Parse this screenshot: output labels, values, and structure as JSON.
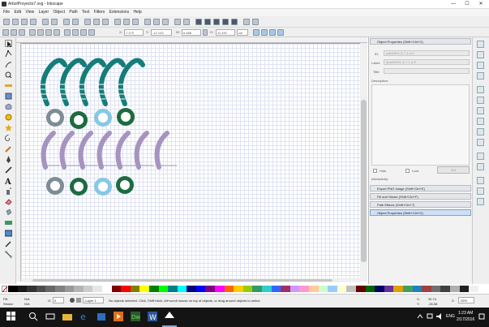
{
  "window": {
    "title": "ArbolProyecto7.svg - Inkscape",
    "buttons": [
      "—",
      "☐",
      "✕"
    ]
  },
  "menubar": [
    "File",
    "Edit",
    "View",
    "Layer",
    "Object",
    "Path",
    "Text",
    "Filters",
    "Extensions",
    "Help"
  ],
  "controls": {
    "x_label": "X:",
    "x_value": "7.270",
    "y_label": "Y:",
    "y_value": "-12.143",
    "w_label": "W:",
    "w_value": "6.488",
    "h_label": "H:",
    "h_value": "11.491",
    "unit": "cm"
  },
  "object_properties": {
    "header": "Object Properties (Shift+Ctrl+O)",
    "id_label": "ID:",
    "id_value": "path0901-3-7-1-4-9",
    "label_label": "Label:",
    "label_value": "#path0901-3-7-1-4-9",
    "title_label": "Title:",
    "title_value": "",
    "description_label": "Description:",
    "hide_label": "Hide",
    "lock_label": "Lock",
    "set_label": "Set",
    "interactivity_label": "Interactivity"
  },
  "docked_panels": [
    "Export PNG Image (Shift+Ctrl+E)",
    "Fill and Stroke (Shift+Ctrl+F)",
    "Path Effects (Shift+Ctrl+7)",
    "Object Properties (Shift+Ctrl+O)"
  ],
  "palette_colors": [
    "#000000",
    "#1a1a1a",
    "#333333",
    "#4d4d4d",
    "#666666",
    "#808080",
    "#999999",
    "#b3b3b3",
    "#cccccc",
    "#e6e6e6",
    "#ffffff",
    "#800000",
    "#ff0000",
    "#808000",
    "#ffff00",
    "#008000",
    "#00ff00",
    "#008080",
    "#00ffff",
    "#000080",
    "#0000ff",
    "#800080",
    "#ff00ff",
    "#ff6600",
    "#ffcc00",
    "#99cc00",
    "#339966",
    "#33cccc",
    "#3366ff",
    "#993366",
    "#cc99ff",
    "#ff99cc",
    "#ffcc99",
    "#ccffcc",
    "#99ccff",
    "#ffffcc",
    "#c0c0c0",
    "#660000",
    "#006600",
    "#000066",
    "#663399",
    "#e0a000",
    "#40a060",
    "#2080c0",
    "#a04040",
    "#707070",
    "#404040",
    "#b0b0b0",
    "#202020",
    "#f0f0f0"
  ],
  "status": {
    "fill_label": "Fill:",
    "fill_value": "N/A",
    "stroke_label": "Stroke:",
    "stroke_value": "N/A",
    "opacity_label": "O:",
    "opacity_value": "0",
    "layer": "-Layer 1",
    "message": "No objects selected. Click, Shift+click, Alt+scroll mouse on top of objects, or drag around objects to select.",
    "x_label": "X:",
    "x_value": "32.74",
    "y_label": "Y:",
    "y_value": "-26.58",
    "z_label": "Z:",
    "zoom_value": "25%"
  },
  "taskbar": {
    "lang": "ENG",
    "time": "1:23 AM",
    "date": "2/17/2016"
  },
  "colors": {
    "teal": "#147d7a",
    "lavender": "#a694c0",
    "dark_green": "#1d6b3f",
    "light_blue": "#86c8e6",
    "gray_ring": "#7e8c95",
    "selected_panel": "#cfe0f4"
  }
}
